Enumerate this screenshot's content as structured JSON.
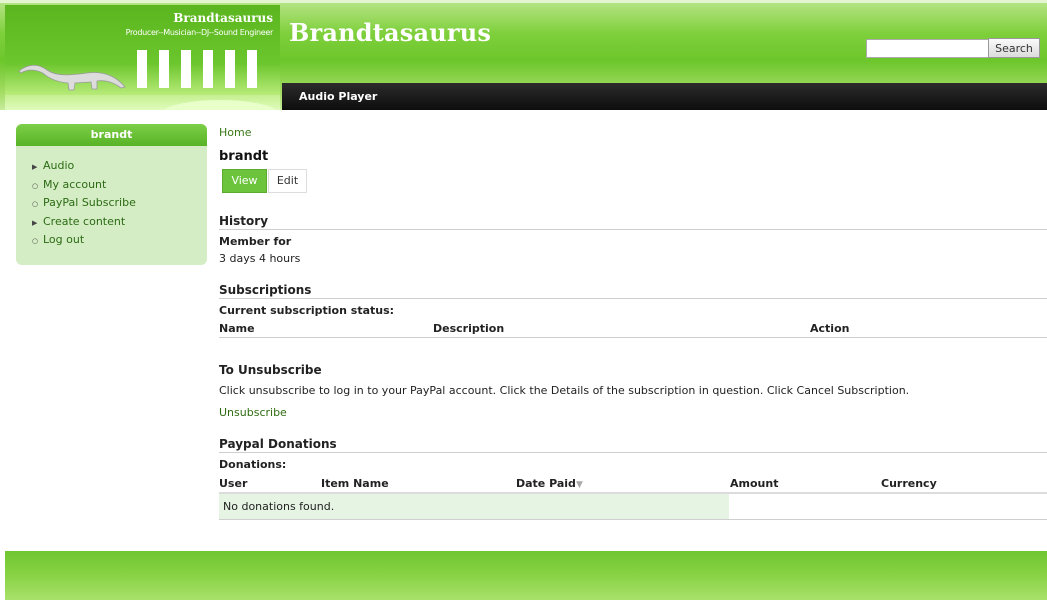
{
  "header": {
    "logo_title": "Brandtasaurus",
    "logo_tagline": "Producer--Musician--DJ--Sound Engineer",
    "site_name": "Brandtasaurus",
    "search_placeholder": "",
    "search_button": "Search",
    "nav": [
      "Audio Player"
    ]
  },
  "sidebar": {
    "title": "brandt",
    "items": [
      {
        "label": "Audio",
        "bullet": "collapsed"
      },
      {
        "label": "My account",
        "bullet": "leaf"
      },
      {
        "label": "PayPal Subscribe",
        "bullet": "leaf"
      },
      {
        "label": "Create content",
        "bullet": "collapsed"
      },
      {
        "label": "Log out",
        "bullet": "leaf"
      }
    ]
  },
  "main": {
    "breadcrumb": "Home",
    "title": "brandt",
    "tabs": [
      "View",
      "Edit"
    ],
    "history": {
      "heading": "History",
      "member_label": "Member for",
      "member_value": "3 days 4 hours"
    },
    "subscriptions": {
      "heading": "Subscriptions",
      "status_label": "Current subscription status:",
      "columns": [
        "Name",
        "Description",
        "Action"
      ]
    },
    "unsubscribe": {
      "heading": "To Unsubscribe",
      "text": "Click unsubscribe to log in to your PayPal account. Click the Details of the subscription in question. Click Cancel Subscription.",
      "link": "Unsubscribe"
    },
    "donations": {
      "heading": "Paypal Donations",
      "label": "Donations:",
      "columns": [
        "User",
        "Item Name",
        "Date Paid",
        "Amount",
        "Currency"
      ],
      "empty_text": "No donations found."
    }
  },
  "colors": {
    "accent_green": "#6cc33c",
    "sidebar_bg": "#d4edc5",
    "nav_bg": "#1a1a1a"
  }
}
